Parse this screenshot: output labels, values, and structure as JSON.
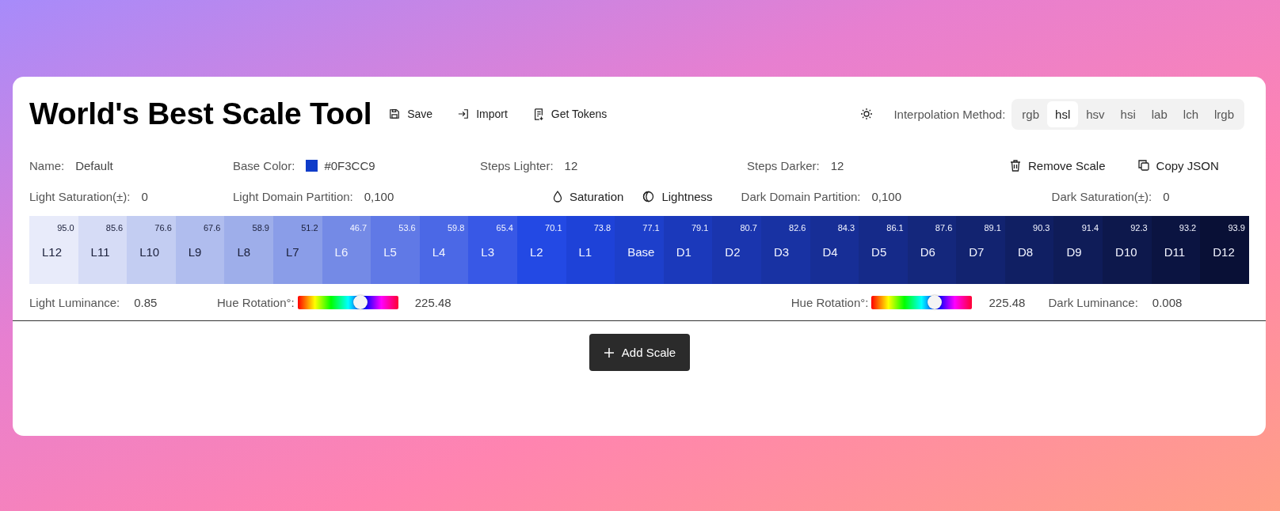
{
  "header": {
    "title": "World's Best Scale Tool",
    "actions": [
      {
        "kind": "save",
        "label": "Save"
      },
      {
        "kind": "import",
        "label": "Import"
      },
      {
        "kind": "tokens",
        "label": "Get Tokens"
      }
    ],
    "interpolation_label": "Interpolation Method:",
    "methods": [
      {
        "label": "rgb",
        "selected": false
      },
      {
        "label": "hsl",
        "selected": true
      },
      {
        "label": "hsv",
        "selected": false
      },
      {
        "label": "hsi",
        "selected": false
      },
      {
        "label": "lab",
        "selected": false
      },
      {
        "label": "lch",
        "selected": false
      },
      {
        "label": "lrgb",
        "selected": false
      }
    ]
  },
  "settings": {
    "name_label": "Name:",
    "name": "Default",
    "base_label": "Base Color:",
    "base_value": "#0F3CC9",
    "steps_lighter_label": "Steps Lighter:",
    "steps_lighter": "12",
    "steps_darker_label": "Steps Darker:",
    "steps_darker": "12",
    "remove": "Remove Scale",
    "copy": "Copy JSON",
    "light_saturation_label": "Light Saturation(±):",
    "light_saturation": "0",
    "light_domain_label": "Light Domain Partition:",
    "light_domain": "0,100",
    "saturation_toggle": "Saturation",
    "lightness_toggle": "Lightness",
    "dark_domain_label": "Dark Domain Partition:",
    "dark_domain": "0,100",
    "dark_saturation_label": "Dark Saturation(±):",
    "dark_saturation": "0"
  },
  "swatches": [
    {
      "label": "L12",
      "value": "95.0",
      "color": "#e8ebfa",
      "light_text": false
    },
    {
      "label": "L11",
      "value": "85.6",
      "color": "#d6dcf6",
      "light_text": false
    },
    {
      "label": "L10",
      "value": "76.6",
      "color": "#c3cdf2",
      "light_text": false
    },
    {
      "label": "L9",
      "value": "67.6",
      "color": "#b0bdee",
      "light_text": false
    },
    {
      "label": "L8",
      "value": "58.9",
      "color": "#9eaeea",
      "light_text": false
    },
    {
      "label": "L7",
      "value": "51.2",
      "color": "#8a9de8",
      "light_text": false
    },
    {
      "label": "L6",
      "value": "46.7",
      "color": "#748ae6",
      "light_text": true
    },
    {
      "label": "L5",
      "value": "53.6",
      "color": "#6079e6",
      "light_text": true
    },
    {
      "label": "L4",
      "value": "59.8",
      "color": "#4b68e6",
      "light_text": true
    },
    {
      "label": "L3",
      "value": "65.4",
      "color": "#3858e6",
      "light_text": true
    },
    {
      "label": "L2",
      "value": "70.1",
      "color": "#2349e4",
      "light_text": true
    },
    {
      "label": "L1",
      "value": "73.8",
      "color": "#1e42d8",
      "light_text": true
    },
    {
      "label": "Base",
      "value": "77.1",
      "color": "#1d3fcb",
      "light_text": true
    },
    {
      "label": "D1",
      "value": "79.1",
      "color": "#1b39bb",
      "light_text": true
    },
    {
      "label": "D2",
      "value": "80.7",
      "color": "#1a35ae",
      "light_text": true
    },
    {
      "label": "D3",
      "value": "82.6",
      "color": "#1832a3",
      "light_text": true
    },
    {
      "label": "D4",
      "value": "84.3",
      "color": "#172e96",
      "light_text": true
    },
    {
      "label": "D5",
      "value": "86.1",
      "color": "#152a89",
      "light_text": true
    },
    {
      "label": "D6",
      "value": "87.6",
      "color": "#14277c",
      "light_text": true
    },
    {
      "label": "D7",
      "value": "89.1",
      "color": "#122370",
      "light_text": true
    },
    {
      "label": "D8",
      "value": "90.3",
      "color": "#101f63",
      "light_text": true
    },
    {
      "label": "D9",
      "value": "91.4",
      "color": "#0f1c58",
      "light_text": true
    },
    {
      "label": "D10",
      "value": "92.3",
      "color": "#0d184c",
      "light_text": true
    },
    {
      "label": "D11",
      "value": "93.2",
      "color": "#0b1441",
      "light_text": true
    },
    {
      "label": "D12",
      "value": "93.9",
      "color": "#091036",
      "light_text": true
    }
  ],
  "controls": {
    "light_luminance_label": "Light Luminance:",
    "light_luminance": "0.85",
    "light_hue_label": "Hue Rotation°:",
    "light_hue": {
      "level": 0.626
    },
    "light_hue_value": "225.48",
    "dark_hue_label": "Hue Rotation°:",
    "dark_hue": {
      "level": 0.626
    },
    "dark_hue_value": "225.48",
    "dark_luminance_label": "Dark Luminance:",
    "dark_luminance": "0.008"
  },
  "add_button": "Add Scale"
}
